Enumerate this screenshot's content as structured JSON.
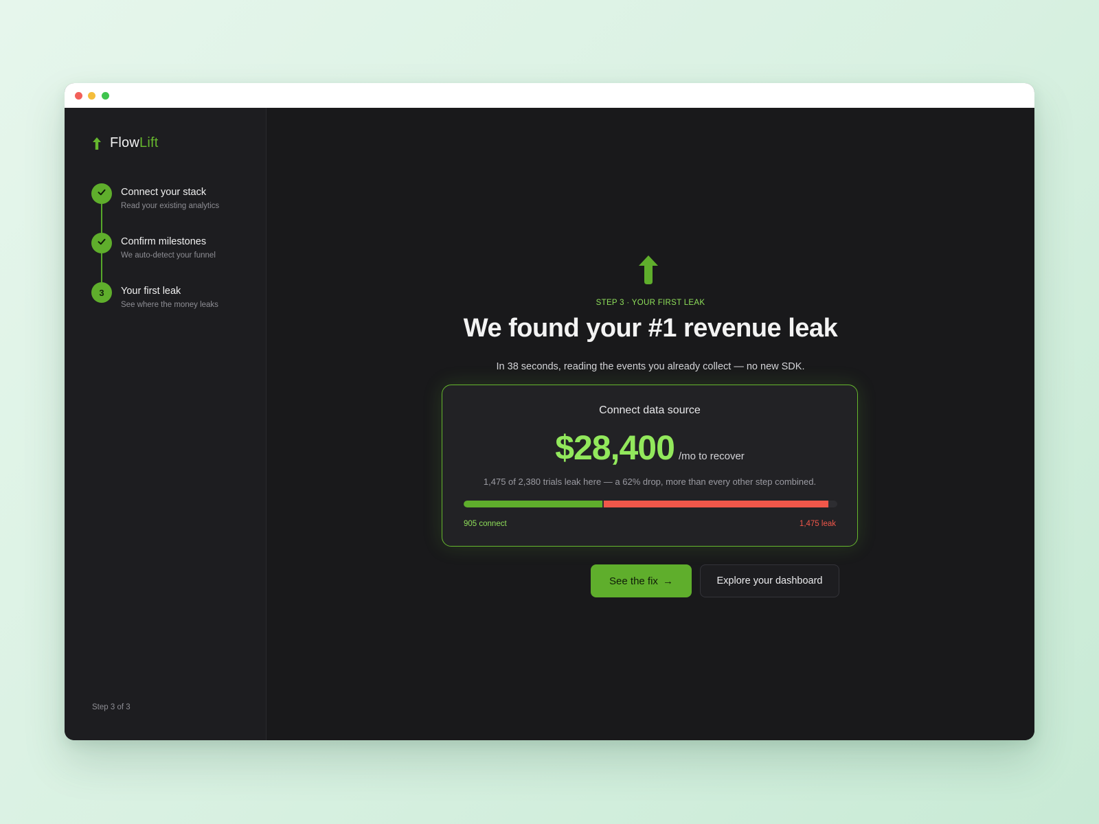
{
  "brand": {
    "name_part1": "Flow",
    "name_part2": "Lift",
    "logo_icon": "arrow-up-icon",
    "accent": "#66b72e"
  },
  "sidebar": {
    "steps": [
      {
        "title": "Connect your stack",
        "subtitle": "Read your existing analytics",
        "status": "done",
        "icon": "check-icon"
      },
      {
        "title": "Confirm milestones",
        "subtitle": "We auto-detect your funnel",
        "status": "done",
        "icon": "check-icon"
      },
      {
        "title": "Your first leak",
        "subtitle": "See where the money leaks",
        "status": "current",
        "number": "3"
      }
    ],
    "step_count": "Step 3 of 3"
  },
  "main": {
    "eyebrow": "STEP 3 · YOUR FIRST LEAK",
    "headline": "We found your #1 revenue leak",
    "subline": "In 38 seconds, reading the events you already collect — no new SDK.",
    "card": {
      "title": "Connect data source",
      "amount": "$28,400",
      "amount_unit": "/mo to recover",
      "description": "1,475 of 2,380 trials leak here — a 62% drop, more than every other step combined.",
      "connect_value": 905,
      "leak_value": 1475,
      "bar_fill_fraction": 0.977,
      "connect_label": "905 connect",
      "leak_label": "1,475 leak",
      "connect_color": "#5fae2c",
      "leak_color": "#f1574a"
    },
    "primary_button": {
      "label": "See the fix",
      "icon": "arrow-right-icon"
    },
    "secondary_button": {
      "label": "Explore your dashboard"
    }
  }
}
